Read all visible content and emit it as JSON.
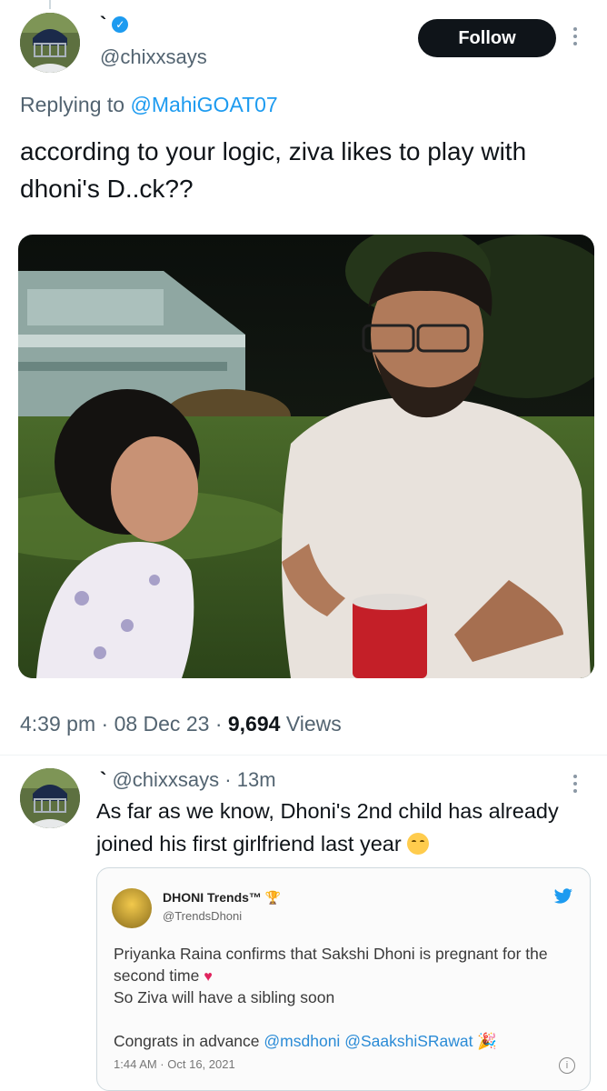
{
  "tweet": {
    "display_name": "`",
    "handle": "@chixxsays",
    "follow_label": "Follow",
    "replying_prefix": "Replying to",
    "replying_to": "@MahiGOAT07",
    "text": "according to your logic, ziva likes to play with dhoni's D..ck??",
    "time": "4:39 pm",
    "sep1": "·",
    "date": "08 Dec 23",
    "sep2": "·",
    "views_count": "9,694",
    "views_label": "Views"
  },
  "reply": {
    "display_name": "`",
    "handle": "@chixxsays",
    "sep": "·",
    "age": "13m",
    "text": "As far as we know, Dhoni's 2nd child has already joined his first girlfriend last year",
    "emoji": "relieved-face",
    "quote": {
      "name": "DHONI Trends™",
      "handle": "@TrendsDhoni",
      "line1": "Priyanka Raina confirms that Sakshi Dhoni is pregnant for the second time",
      "line2": "So Ziva will have a sibling soon",
      "congrats": "Congrats in advance",
      "mention1": "@msdhoni",
      "mention2": "@SaakshiSRawat",
      "timestamp": "1:44 AM · Oct 16, 2021"
    }
  },
  "colors": {
    "accent": "#1d9bf0",
    "text": "#0f1419",
    "muted": "#536471",
    "follow_bg": "#0f1419"
  }
}
